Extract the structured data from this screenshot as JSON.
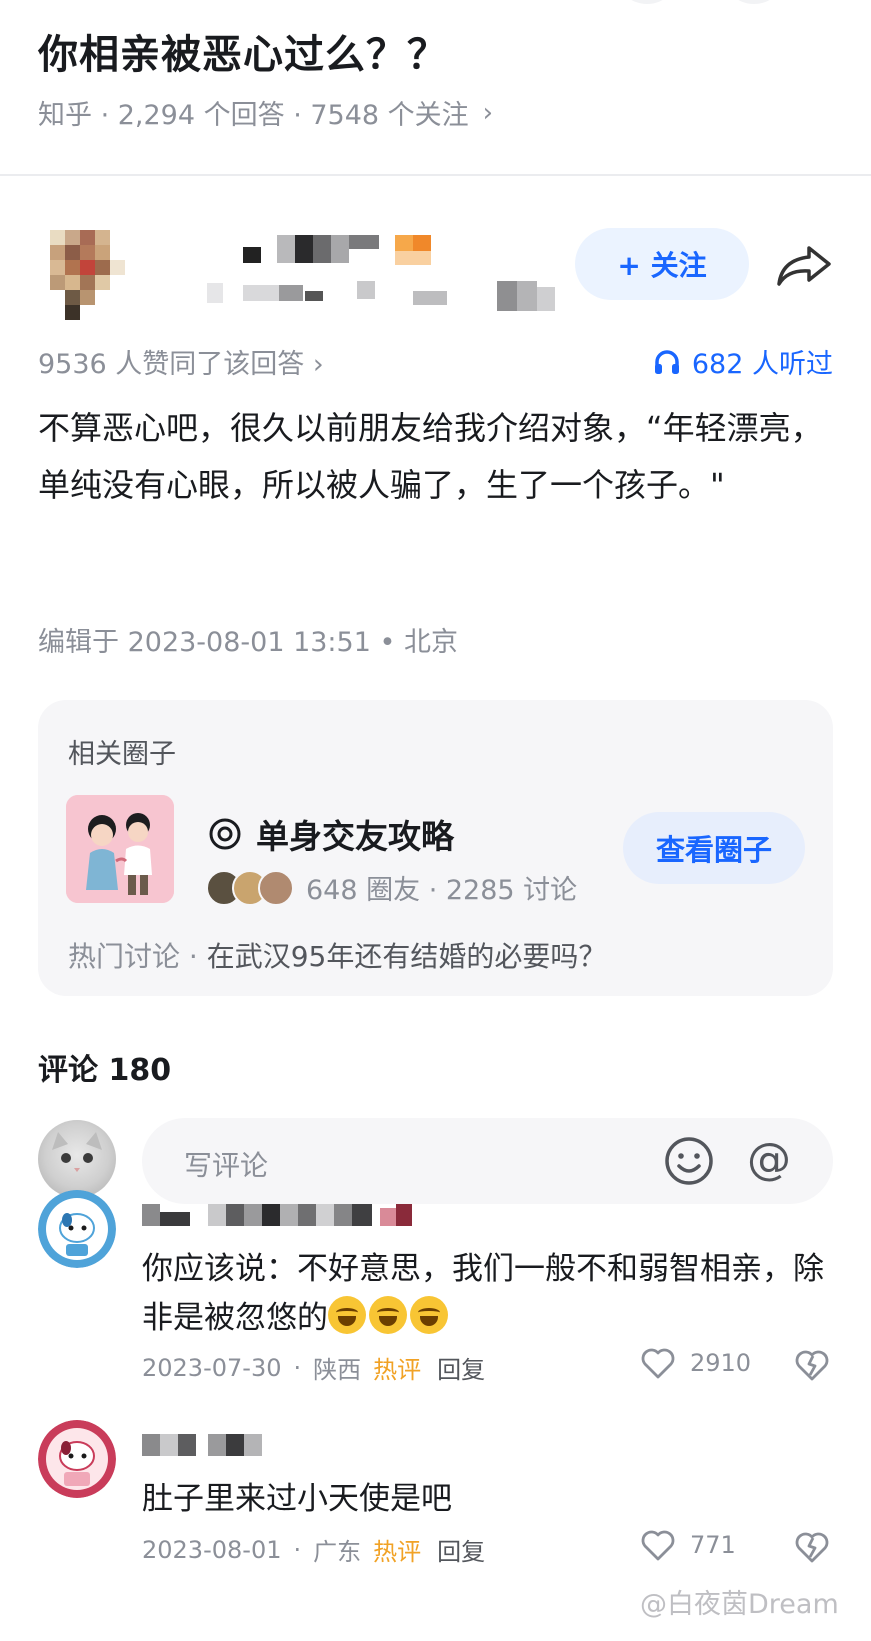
{
  "question": {
    "title": "你相亲被恶心过么？？",
    "meta": "知乎 · 2,294 个回答 · 7548 个关注",
    "chevron": "›"
  },
  "answer": {
    "follow_label": "+ 关注",
    "likes_text": "9536 人赞同了该回答 ›",
    "listen_text": "682 人听过",
    "body": "不算恶心吧，很久以前朋友给我介绍对象，“年轻漂亮，单纯没有心眼，所以被人骗了，生了一个孩子。\"",
    "edited": "编辑于 2023-08-01 13:51 • 北京"
  },
  "related_circle": {
    "label": "相关圈子",
    "name": "单身交友攻略",
    "stats": "648 圈友 · 2285 讨论",
    "button": "查看圈子",
    "hot_prefix": "热门讨论 · ",
    "hot_topic": "在武汉95年还有结婚的必要吗？"
  },
  "comments": {
    "title": "评论 180",
    "input_placeholder": "写评论",
    "at_symbol": "@",
    "items": [
      {
        "text": "你应该说：不好意思，我们一般不和弱智相亲，除非是被忽悠的",
        "date": "2023-07-30",
        "location": "陕西",
        "hot": "热评",
        "reply": "回复",
        "likes": "2910"
      },
      {
        "text": "肚子里来过小天使是吧",
        "date": "2023-08-01",
        "location": "广东",
        "hot": "热评",
        "reply": "回复",
        "likes": "771"
      }
    ]
  },
  "watermark": "@白夜茵Dream",
  "colors": {
    "accent": "#1966ff",
    "hot": "#f1a225",
    "muted": "#8b8f98"
  }
}
